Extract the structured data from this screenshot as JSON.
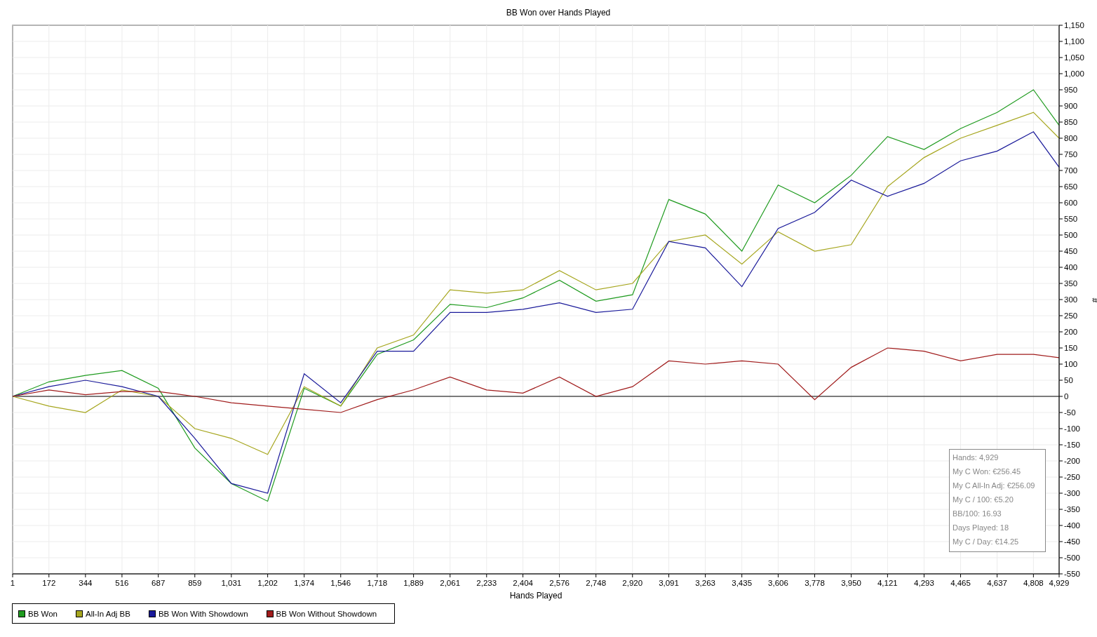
{
  "chart_data": {
    "type": "line",
    "title": "BB Won over Hands Played",
    "xlabel": "Hands Played",
    "ylabel": "#",
    "x": [
      1,
      172,
      344,
      516,
      687,
      859,
      1031,
      1202,
      1374,
      1546,
      1718,
      1889,
      2061,
      2233,
      2404,
      2576,
      2748,
      2920,
      3091,
      3263,
      3435,
      3606,
      3778,
      3950,
      4121,
      4293,
      4465,
      4637,
      4808,
      4929
    ],
    "series": [
      {
        "name": "BB Won",
        "color": "#1f9b1f",
        "values": [
          0,
          45,
          65,
          80,
          25,
          -160,
          -270,
          -325,
          25,
          -30,
          130,
          175,
          285,
          275,
          305,
          360,
          295,
          315,
          610,
          565,
          450,
          655,
          600,
          685,
          805,
          765,
          830,
          880,
          950,
          840
        ]
      },
      {
        "name": "All-In Adj BB",
        "color": "#a6a61e",
        "values": [
          0,
          -30,
          -50,
          20,
          0,
          -100,
          -130,
          -180,
          30,
          -30,
          150,
          190,
          330,
          320,
          330,
          390,
          330,
          350,
          480,
          500,
          410,
          510,
          450,
          470,
          650,
          740,
          800,
          840,
          880,
          800
        ]
      },
      {
        "name": "BB Won With Showdown",
        "color": "#1a1a9a",
        "values": [
          0,
          30,
          50,
          30,
          0,
          -130,
          -270,
          -300,
          70,
          -20,
          140,
          140,
          260,
          260,
          270,
          290,
          260,
          270,
          480,
          460,
          340,
          520,
          570,
          670,
          620,
          660,
          730,
          760,
          820,
          710
        ]
      },
      {
        "name": "BB Won Without Showdown",
        "color": "#a01b1b",
        "values": [
          0,
          20,
          5,
          15,
          15,
          0,
          -20,
          -30,
          -40,
          -50,
          -10,
          20,
          60,
          20,
          10,
          60,
          0,
          30,
          110,
          100,
          110,
          100,
          -10,
          90,
          150,
          140,
          110,
          130,
          130,
          120
        ]
      }
    ],
    "grid": true,
    "xlim": [
      1,
      4929
    ],
    "ylim": [
      -550,
      1150
    ],
    "xticks": [
      {
        "value": 1,
        "label": "1"
      },
      {
        "value": 172,
        "label": "172"
      },
      {
        "value": 344,
        "label": "344"
      },
      {
        "value": 516,
        "label": "516"
      },
      {
        "value": 687,
        "label": "687"
      },
      {
        "value": 859,
        "label": "859"
      },
      {
        "value": 1031,
        "label": "1,031"
      },
      {
        "value": 1202,
        "label": "1,202"
      },
      {
        "value": 1374,
        "label": "1,374"
      },
      {
        "value": 1546,
        "label": "1,546"
      },
      {
        "value": 1718,
        "label": "1,718"
      },
      {
        "value": 1889,
        "label": "1,889"
      },
      {
        "value": 2061,
        "label": "2,061"
      },
      {
        "value": 2233,
        "label": "2,233"
      },
      {
        "value": 2404,
        "label": "2,404"
      },
      {
        "value": 2576,
        "label": "2,576"
      },
      {
        "value": 2748,
        "label": "2,748"
      },
      {
        "value": 2920,
        "label": "2,920"
      },
      {
        "value": 3091,
        "label": "3,091"
      },
      {
        "value": 3263,
        "label": "3,263"
      },
      {
        "value": 3435,
        "label": "3,435"
      },
      {
        "value": 3606,
        "label": "3,606"
      },
      {
        "value": 3778,
        "label": "3,778"
      },
      {
        "value": 3950,
        "label": "3,950"
      },
      {
        "value": 4121,
        "label": "4,121"
      },
      {
        "value": 4293,
        "label": "4,293"
      },
      {
        "value": 4465,
        "label": "4,465"
      },
      {
        "value": 4637,
        "label": "4,637"
      },
      {
        "value": 4808,
        "label": "4,808"
      },
      {
        "value": 4929,
        "label": "4,929"
      }
    ],
    "yticks": [
      {
        "value": -550,
        "label": "-550"
      },
      {
        "value": -500,
        "label": "-500"
      },
      {
        "value": -450,
        "label": "-450"
      },
      {
        "value": -400,
        "label": "-400"
      },
      {
        "value": -350,
        "label": "-350"
      },
      {
        "value": -300,
        "label": "-300"
      },
      {
        "value": -250,
        "label": "-250"
      },
      {
        "value": -200,
        "label": "-200"
      },
      {
        "value": -150,
        "label": "-150"
      },
      {
        "value": -100,
        "label": "-100"
      },
      {
        "value": -50,
        "label": "-50"
      },
      {
        "value": 0,
        "label": "0"
      },
      {
        "value": 50,
        "label": "50"
      },
      {
        "value": 100,
        "label": "100"
      },
      {
        "value": 150,
        "label": "150"
      },
      {
        "value": 200,
        "label": "200"
      },
      {
        "value": 250,
        "label": "250"
      },
      {
        "value": 300,
        "label": "300"
      },
      {
        "value": 350,
        "label": "350"
      },
      {
        "value": 400,
        "label": "400"
      },
      {
        "value": 450,
        "label": "450"
      },
      {
        "value": 500,
        "label": "500"
      },
      {
        "value": 550,
        "label": "550"
      },
      {
        "value": 600,
        "label": "600"
      },
      {
        "value": 650,
        "label": "650"
      },
      {
        "value": 700,
        "label": "700"
      },
      {
        "value": 750,
        "label": "750"
      },
      {
        "value": 800,
        "label": "800"
      },
      {
        "value": 850,
        "label": "850"
      },
      {
        "value": 900,
        "label": "900"
      },
      {
        "value": 950,
        "label": "950"
      },
      {
        "value": 1000,
        "label": "1,000"
      },
      {
        "value": 1050,
        "label": "1,050"
      },
      {
        "value": 1100,
        "label": "1,100"
      },
      {
        "value": 1150,
        "label": "1,150"
      }
    ]
  },
  "stats_box": {
    "lines": [
      "Hands: 4,929",
      "My C Won: €256.45",
      "My C All-In Adj: €256.09",
      "My C / 100: €5.20",
      "BB/100: 16.93",
      "Days Played: 18",
      "My C / Day: €14.25"
    ]
  }
}
